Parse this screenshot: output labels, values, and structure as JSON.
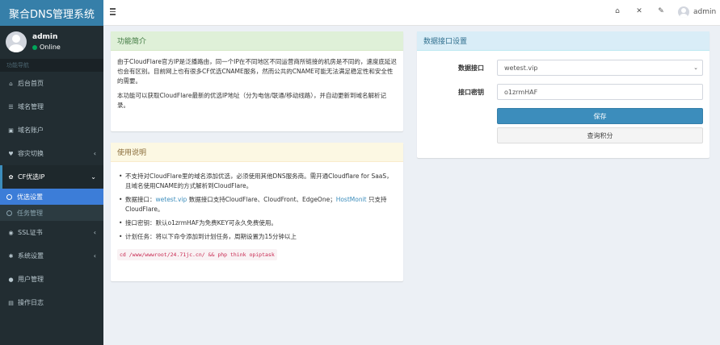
{
  "app": {
    "title": "聚合DNS管理系统"
  },
  "user": {
    "name": "admin",
    "status": "Online"
  },
  "sidebar": {
    "header": "功能导航",
    "items": [
      {
        "label": "后台首页",
        "icon": "home-icon"
      },
      {
        "label": "域名管理",
        "icon": "list-icon"
      },
      {
        "label": "域名账户",
        "icon": "lock-icon"
      },
      {
        "label": "容灾切换",
        "icon": "heart-icon"
      },
      {
        "label": "CF优选IP",
        "icon": "gear-icon"
      },
      {
        "label": "SSL证书",
        "icon": "globe-icon"
      },
      {
        "label": "系统设置",
        "icon": "cogs-icon"
      },
      {
        "label": "用户管理",
        "icon": "user-icon"
      },
      {
        "label": "操作日志",
        "icon": "list-alt-icon"
      }
    ],
    "subitems": [
      {
        "label": "优选设置"
      },
      {
        "label": "任务管理"
      }
    ]
  },
  "topbar": {
    "username": "admin"
  },
  "intro": {
    "title": "功能简介",
    "p1": "由于CloudFlare官方IP是泛播路由，同一个IP在不同地区不同运营商所链接的机房是不同的，速度底延迟也会有区别。目前网上也有很多CF优选CNAME服务，然而公共的CNAME可能无法满足稳定性和安全性的需要。",
    "p2": "本功能可以获取CloudFlare最新的优选IP地址（分为电信/联通/移动线路），并自动更新到域名解析记录。"
  },
  "usage": {
    "title": "使用说明",
    "item1": "不支持对CloudFlare里的域名添加优选，必须使用其他DNS服务商。需开通Cloudflare for SaaS，且域名使用CNAME的方式解析到CloudFlare。",
    "item2_pre": "数据接口：",
    "item2_link": "wetest.vip",
    "item2_mid": " 数据接口支持CloudFlare、CloudFront、EdgeOne；",
    "item2_link2": "HostMonit",
    "item2_post": " 只支持CloudFlare。",
    "item3": "接口密钥：默认o1zrmHAF为免费KEY可永久免费使用。",
    "item4": "计划任务：将以下命令添加到计划任务，周期设置为15分钟以上",
    "command": "cd /www/wwwroot/24.71jc.cn/ && php think opiptask"
  },
  "settings": {
    "title": "数据接口设置",
    "api_label": "数据接口",
    "api_value": "wetest.vip",
    "key_label": "接口密钥",
    "key_value": "o1zrmHAF",
    "save_label": "保存",
    "query_label": "查询积分"
  },
  "colors": {
    "sidebar": "#222d32",
    "accent": "#3c8dbc",
    "active_sub": "#3c7dd8"
  }
}
